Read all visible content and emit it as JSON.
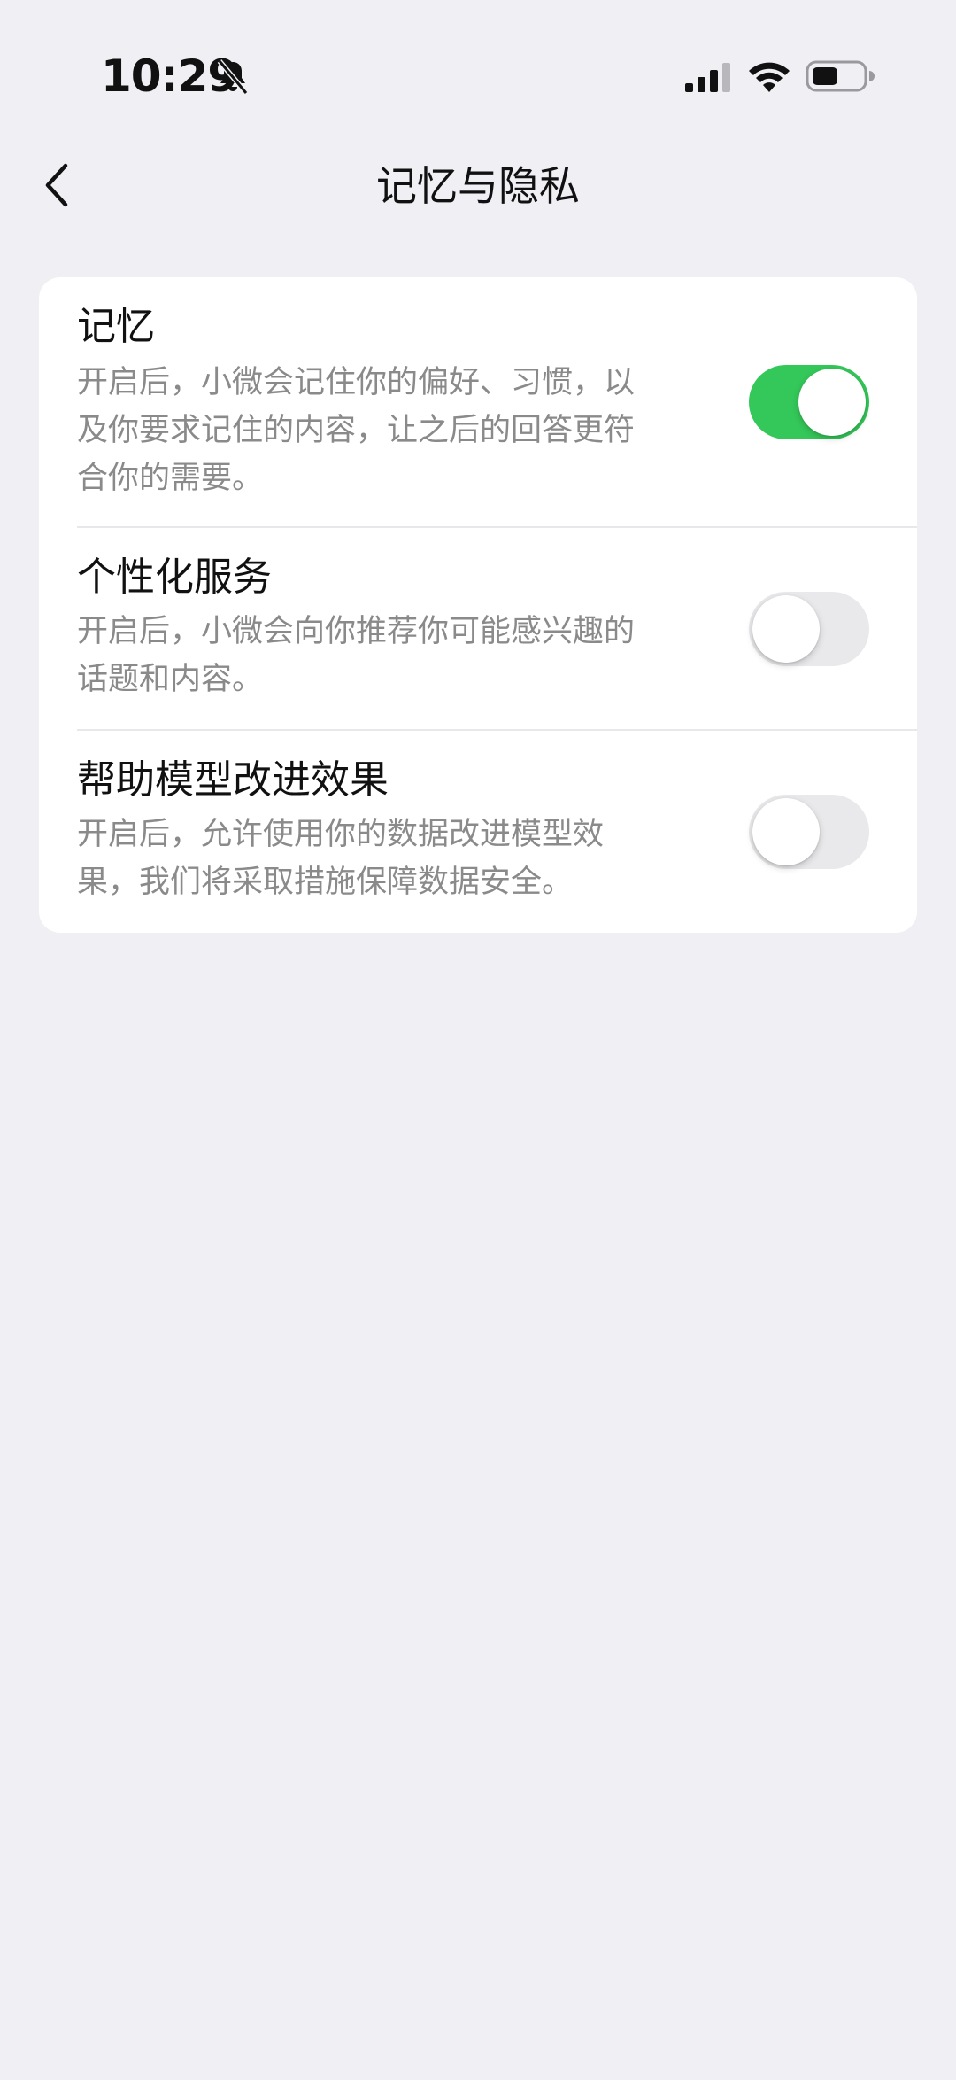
{
  "status_bar": {
    "time": "10:29",
    "icons": [
      "bell-slash-icon",
      "cellular-signal-icon",
      "wifi-icon",
      "battery-icon"
    ]
  },
  "nav": {
    "title": "记忆与隐私",
    "back_icon": "chevron-left-icon"
  },
  "settings": {
    "items": [
      {
        "title": "记忆",
        "desc_lines": [
          "开启后，小微会记住你的偏好、习惯，以",
          "及你要求记住的内容，让之后的回答更符",
          "合你的需要。"
        ],
        "enabled": true
      },
      {
        "title": "个性化服务",
        "desc_lines": [
          "开启后，小微会向你推荐你可能感兴趣的",
          "话题和内容。"
        ],
        "enabled": false
      },
      {
        "title": "帮助模型改进效果",
        "desc_lines": [
          "开启后，允许使用你的数据改进模型效",
          "果，我们将采取措施保障数据安全。"
        ],
        "enabled": false
      }
    ]
  },
  "colors": {
    "background": "#EFEFF4",
    "card": "#FFFFFF",
    "toggle_on": "#34C759",
    "toggle_off": "#E9E9EB",
    "secondary_text": "#8A8A8A"
  }
}
